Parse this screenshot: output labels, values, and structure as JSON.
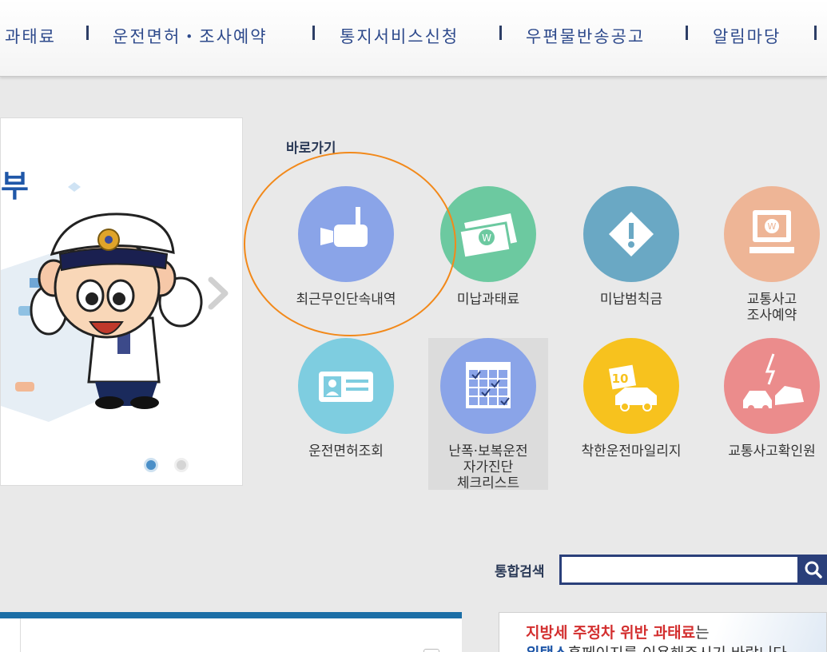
{
  "nav": {
    "items": [
      "과태료",
      "운전면허・조사예약",
      "통지서비스신청",
      "우편물반송공고",
      "알림마당"
    ]
  },
  "banner": {
    "headline": "부"
  },
  "quick": {
    "title": "바로가기",
    "tiles": [
      {
        "label": "최근무인단속내역",
        "color": "#8aa4e8",
        "icon": "camera-icon"
      },
      {
        "label": "미납과태료",
        "color": "#6cc9a0",
        "icon": "money-icon"
      },
      {
        "label": "미납범칙금",
        "color": "#6aa8c4",
        "icon": "warning-diamond-icon"
      },
      {
        "label": "교통사고\n조사예약",
        "color": "#eeb596",
        "icon": "monitor-icon"
      },
      {
        "label": "운전면허조회",
        "color": "#7ecde0",
        "icon": "id-card-icon"
      },
      {
        "label": "난폭·보복운전\n자가진단\n체크리스트",
        "color": "#8aa4e8",
        "icon": "checklist-icon"
      },
      {
        "label": "착한운전마일리지",
        "color": "#f7c21e",
        "icon": "mileage-car-icon"
      },
      {
        "label": "교통사고확인원",
        "color": "#eb8c8c",
        "icon": "car-crash-icon"
      }
    ]
  },
  "search": {
    "label": "통합검색",
    "value": ""
  },
  "left_panel": {
    "tab_text": "...."
  },
  "notice": {
    "line1_red": "지방세 주정차 위반 과태료",
    "line1_dark": "는",
    "line2_brand": "위택스",
    "line2_rest": "홈페이지를 이용해주시기 바랍니다."
  },
  "colors": {
    "nav_text": "#2e4a8c",
    "highlight_ring": "#f2891a",
    "search_border": "#2a3f7a",
    "panel_top": "#1b6ea6"
  }
}
